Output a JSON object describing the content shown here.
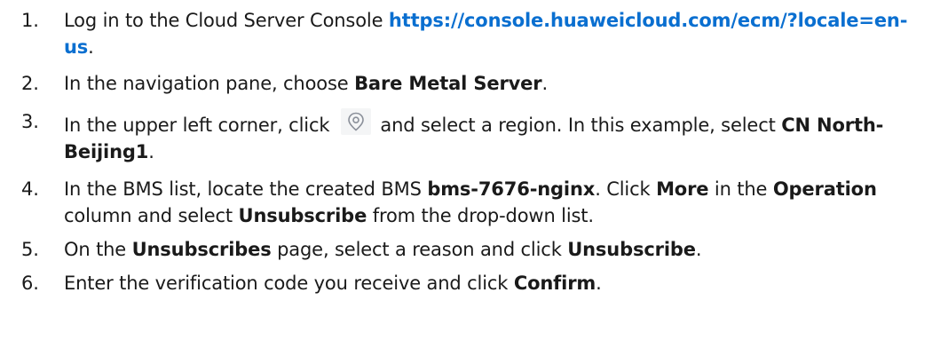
{
  "steps": [
    {
      "num": "1.",
      "pre": "Log in to the Cloud Server Console ",
      "link": "https://console.huaweicloud.com/ecm/?locale=en-us",
      "post": "."
    },
    {
      "num": "2.",
      "pre": "In the navigation pane, choose ",
      "b1": "Bare Metal Server",
      "post": "."
    },
    {
      "num": "3.",
      "pre": "In the upper left corner, click ",
      "icon": "location-pin-icon",
      "mid": " and select a region. In this example, select ",
      "b1": "CN North-Beijing1",
      "post": "."
    },
    {
      "num": "4.",
      "pre": "In the BMS list, locate the created BMS ",
      "b1": "bms-7676-nginx",
      "t1": ". Click ",
      "b2": "More",
      "t2": " in the ",
      "b3": "Operation",
      "t3": " column and select ",
      "b4": "Unsubscribe",
      "post": " from the drop-down list."
    },
    {
      "num": "5.",
      "pre": "On the ",
      "b1": "Unsubscribes",
      "t1": " page, select a reason and click ",
      "b2": "Unsubscribe",
      "post": "."
    },
    {
      "num": "6.",
      "pre": "Enter the verification code you receive and click ",
      "b1": "Confirm",
      "post": "."
    }
  ],
  "colors": {
    "text": "#1a1a1a",
    "link": "#0a6fd0",
    "icon_bg": "#f4f5f6",
    "icon_stroke": "#8a8f99"
  }
}
